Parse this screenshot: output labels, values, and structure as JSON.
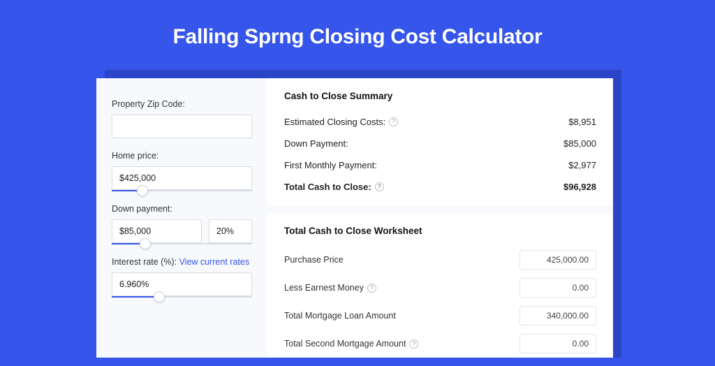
{
  "title": "Falling Sprng Closing Cost Calculator",
  "sidebar": {
    "zip": {
      "label": "Property Zip Code:",
      "value": ""
    },
    "home_price": {
      "label": "Home price:",
      "value": "$425,000",
      "slider_pct": 22
    },
    "down_payment": {
      "label": "Down payment:",
      "value": "$85,000",
      "pct": "20%",
      "slider_pct": 24
    },
    "interest": {
      "label_prefix": "Interest rate (%): ",
      "link_text": "View current rates",
      "value": "6.960%",
      "slider_pct": 34
    }
  },
  "summary": {
    "title": "Cash to Close Summary",
    "rows": [
      {
        "label": "Estimated Closing Costs:",
        "help": true,
        "value": "$8,951",
        "bold": false
      },
      {
        "label": "Down Payment:",
        "help": false,
        "value": "$85,000",
        "bold": false
      },
      {
        "label": "First Monthly Payment:",
        "help": false,
        "value": "$2,977",
        "bold": false
      },
      {
        "label": "Total Cash to Close:",
        "help": true,
        "value": "$96,928",
        "bold": true
      }
    ]
  },
  "worksheet": {
    "title": "Total Cash to Close Worksheet",
    "rows": [
      {
        "label": "Purchase Price",
        "help": false,
        "value": "425,000.00"
      },
      {
        "label": "Less Earnest Money",
        "help": true,
        "value": "0.00"
      },
      {
        "label": "Total Mortgage Loan Amount",
        "help": false,
        "value": "340,000.00"
      },
      {
        "label": "Total Second Mortgage Amount",
        "help": true,
        "value": "0.00"
      }
    ]
  }
}
